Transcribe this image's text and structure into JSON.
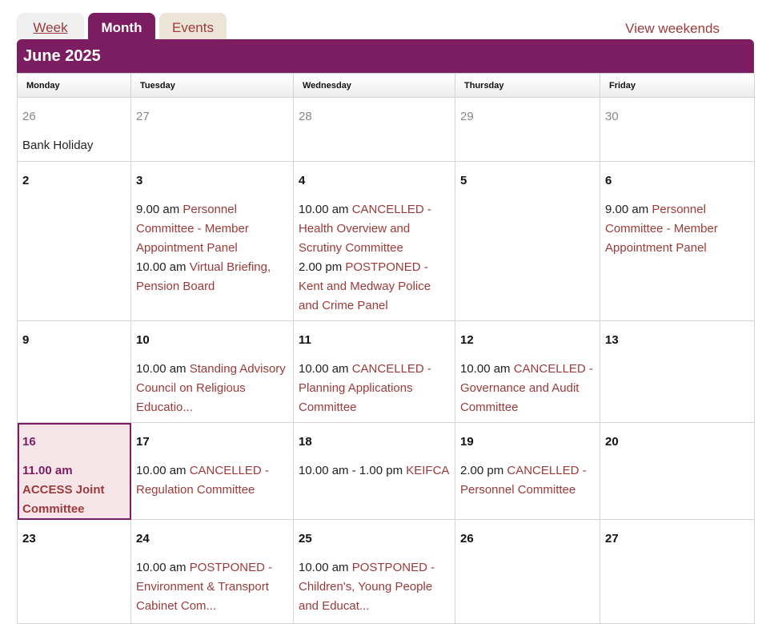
{
  "tabs": {
    "week": "Week",
    "month": "Month",
    "events": "Events",
    "view_weekends": "View weekends"
  },
  "month_title": "June 2025",
  "weekdays": [
    "Monday",
    "Tuesday",
    "Wednesday",
    "Thursday",
    "Friday"
  ],
  "colors": {
    "accent": "#7c1d61",
    "link": "#9b3a3a",
    "today_bg": "#f6e5e8"
  },
  "weeks": [
    [
      {
        "day": "26",
        "other": true,
        "note": "Bank Holiday",
        "events": []
      },
      {
        "day": "27",
        "other": true,
        "events": []
      },
      {
        "day": "28",
        "other": true,
        "events": []
      },
      {
        "day": "29",
        "other": true,
        "events": []
      },
      {
        "day": "30",
        "other": true,
        "events": []
      }
    ],
    [
      {
        "day": "2",
        "events": []
      },
      {
        "day": "3",
        "events": [
          {
            "time": "9.00 am",
            "title": "Personnel Committee - Member Appointment Panel"
          },
          {
            "time": "10.00 am",
            "title": "Virtual Briefing, Pension Board"
          }
        ]
      },
      {
        "day": "4",
        "events": [
          {
            "time": "10.00 am",
            "title": "CANCELLED - Health Overview and Scrutiny Committee"
          },
          {
            "time": "2.00 pm",
            "title": "POSTPONED - Kent and Medway Police and Crime Panel"
          }
        ]
      },
      {
        "day": "5",
        "events": []
      },
      {
        "day": "6",
        "events": [
          {
            "time": "9.00 am",
            "title": "Personnel Committee - Member Appointment Panel"
          }
        ]
      }
    ],
    [
      {
        "day": "9",
        "events": []
      },
      {
        "day": "10",
        "events": [
          {
            "time": "10.00 am",
            "title": "Standing Advisory Council on Religious Educatio..."
          }
        ]
      },
      {
        "day": "11",
        "events": [
          {
            "time": "10.00 am",
            "title": "CANCELLED - Planning Applications Committee"
          }
        ]
      },
      {
        "day": "12",
        "events": [
          {
            "time": "10.00 am",
            "title": "CANCELLED - Governance and Audit Committee"
          }
        ]
      },
      {
        "day": "13",
        "events": []
      }
    ],
    [
      {
        "day": "16",
        "today": true,
        "events": [
          {
            "time": "11.00 am",
            "title": "ACCESS Joint Committee"
          }
        ]
      },
      {
        "day": "17",
        "events": [
          {
            "time": "10.00 am",
            "title": "CANCELLED - Regulation Committee"
          }
        ]
      },
      {
        "day": "18",
        "events": [
          {
            "time": "10.00 am - 1.00 pm",
            "title": "KEIFCA"
          }
        ]
      },
      {
        "day": "19",
        "events": [
          {
            "time": "2.00 pm",
            "title": "CANCELLED - Personnel Committee"
          }
        ]
      },
      {
        "day": "20",
        "events": []
      }
    ],
    [
      {
        "day": "23",
        "events": []
      },
      {
        "day": "24",
        "events": [
          {
            "time": "10.00 am",
            "title": "POSTPONED - Environment & Transport Cabinet Com..."
          }
        ]
      },
      {
        "day": "25",
        "events": [
          {
            "time": "10.00 am",
            "title": "POSTPONED - Children's, Young People and Educat..."
          }
        ]
      },
      {
        "day": "26",
        "events": []
      },
      {
        "day": "27",
        "events": []
      }
    ]
  ]
}
